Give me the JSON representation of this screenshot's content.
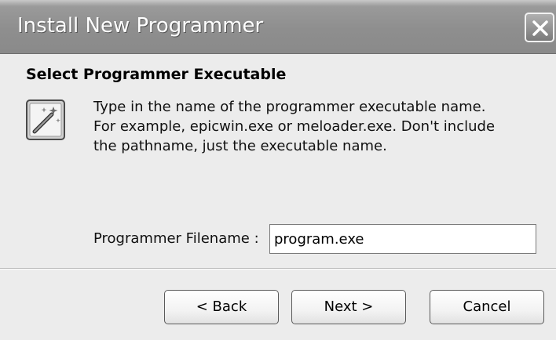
{
  "window": {
    "title": "Install New Programmer"
  },
  "page": {
    "heading": "Select Programmer Executable",
    "description_lines": [
      "Type in the name of the programmer executable name.",
      "For example, epicwin.exe or meloader.exe.  Don't include",
      "the pathname, just the executable name."
    ]
  },
  "form": {
    "filename_label": "Programmer Filename :",
    "filename_value": "program.exe"
  },
  "buttons": {
    "back": "< Back",
    "next": "Next >",
    "cancel": "Cancel"
  },
  "icons": {
    "close": "close-icon",
    "wizard": "wizard-wand-icon"
  }
}
